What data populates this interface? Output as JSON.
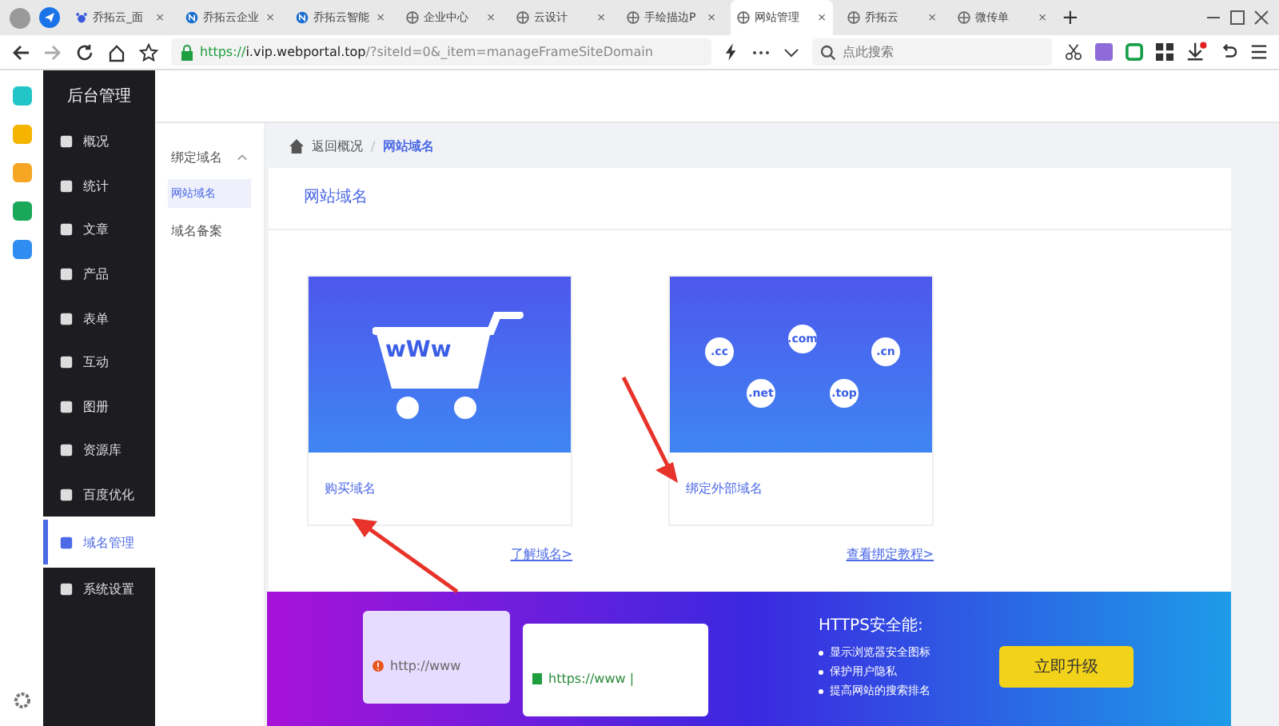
{
  "browser": {
    "tabs": [
      {
        "label": "乔拓云_面",
        "selected": false,
        "kind": "paw",
        "close": "×"
      },
      {
        "label": "乔拓云企业",
        "selected": false,
        "kind": "logo",
        "close": "×"
      },
      {
        "label": "乔拓云智能",
        "selected": false,
        "kind": "logo",
        "close": "×"
      },
      {
        "label": "企业中心",
        "selected": false,
        "kind": "globe",
        "close": "×"
      },
      {
        "label": "云设计",
        "selected": false,
        "kind": "globe",
        "close": "×"
      },
      {
        "label": "手绘描边P",
        "selected": false,
        "kind": "globe",
        "close": "×"
      },
      {
        "label": "网站管理",
        "selected": true,
        "kind": "globe",
        "close": "×"
      },
      {
        "label": "乔拓云",
        "selected": false,
        "kind": "globe",
        "close": "×"
      },
      {
        "label": "微传单",
        "selected": false,
        "kind": "globe",
        "close": "×"
      }
    ],
    "new_tab": "+",
    "url_scheme": "https://",
    "url_host": "i.vip.webportal.top",
    "url_rest": "/?siteId=0&_item=manageFrameSiteDomain",
    "search": {
      "placeholder": "点此搜索"
    }
  },
  "sidebar": {
    "title": "后台管理",
    "items": [
      {
        "label": "概况",
        "selected": false
      },
      {
        "label": "统计",
        "selected": false
      },
      {
        "label": "文章",
        "selected": false
      },
      {
        "label": "产品",
        "selected": false
      },
      {
        "label": "表单",
        "selected": false
      },
      {
        "label": "互动",
        "selected": false
      },
      {
        "label": "图册",
        "selected": false
      },
      {
        "label": "资源库",
        "selected": false
      },
      {
        "label": "百度优化",
        "selected": false
      },
      {
        "label": "域名管理",
        "selected": true
      },
      {
        "label": "系统设置",
        "selected": false
      }
    ]
  },
  "submenu": {
    "group": "绑定域名",
    "expanded": true,
    "items": [
      {
        "label": "网站域名",
        "selected": true
      }
    ],
    "other": "域名备案"
  },
  "breadcrumb": {
    "home": "返回概况",
    "separator": "/",
    "current": "网站域名"
  },
  "panel": {
    "title": "网站域名",
    "cards": [
      {
        "kind": "cart",
        "art_text": "wWw",
        "title": "购买域名",
        "link": "了解域名>"
      },
      {
        "kind": "domains",
        "art_labels": [
          ".cc",
          ".com",
          ".cn",
          ".net",
          ".top"
        ],
        "title": "绑定外部域名",
        "link": "查看绑定教程>"
      }
    ]
  },
  "banner": {
    "url_old": "http://www",
    "url_new": "https://www |",
    "title": "HTTPS安全能:",
    "bullets": [
      "显示浏览器安全图标",
      "保护用户隐私",
      "提高网站的搜索排名"
    ],
    "button": "立即升级"
  }
}
